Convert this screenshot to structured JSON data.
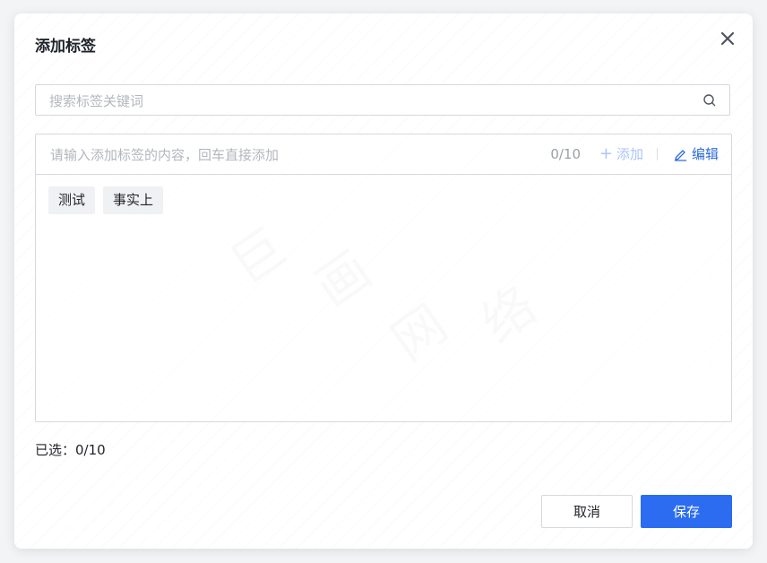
{
  "dialog": {
    "title": "添加标签",
    "close_icon": "close-icon"
  },
  "search": {
    "placeholder": "搜索标签关键词",
    "value": "",
    "icon": "search-icon"
  },
  "tag_input": {
    "placeholder": "请输入添加标签的内容，回车直接添加",
    "counter": "0/10",
    "add_label": "添加",
    "edit_label": "编辑"
  },
  "tags": [
    {
      "label": "测试"
    },
    {
      "label": "事实上"
    }
  ],
  "selected": {
    "text": "已选：0/10"
  },
  "footer": {
    "cancel_label": "取消",
    "save_label": "保存"
  },
  "watermark": [
    "巨",
    "画",
    "网",
    "络"
  ],
  "colors": {
    "primary": "#2b6cf0",
    "add_disabled": "#a9c6f5",
    "border": "#d5d8dd",
    "tag_bg": "#f0f1f3"
  }
}
